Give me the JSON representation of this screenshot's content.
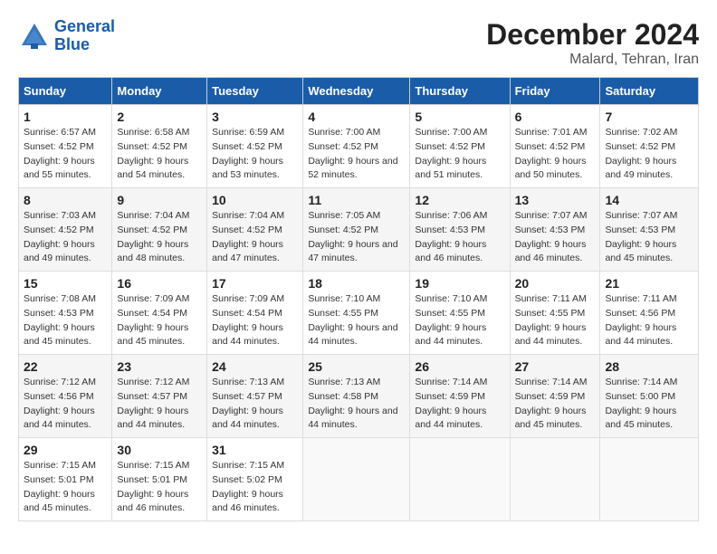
{
  "header": {
    "logo_line1": "General",
    "logo_line2": "Blue",
    "main_title": "December 2024",
    "subtitle": "Malard, Tehran, Iran"
  },
  "days_of_week": [
    "Sunday",
    "Monday",
    "Tuesday",
    "Wednesday",
    "Thursday",
    "Friday",
    "Saturday"
  ],
  "weeks": [
    [
      {
        "day": 1,
        "sunrise": "6:57 AM",
        "sunset": "4:52 PM",
        "daylight": "9 hours and 55 minutes."
      },
      {
        "day": 2,
        "sunrise": "6:58 AM",
        "sunset": "4:52 PM",
        "daylight": "9 hours and 54 minutes."
      },
      {
        "day": 3,
        "sunrise": "6:59 AM",
        "sunset": "4:52 PM",
        "daylight": "9 hours and 53 minutes."
      },
      {
        "day": 4,
        "sunrise": "7:00 AM",
        "sunset": "4:52 PM",
        "daylight": "9 hours and 52 minutes."
      },
      {
        "day": 5,
        "sunrise": "7:00 AM",
        "sunset": "4:52 PM",
        "daylight": "9 hours and 51 minutes."
      },
      {
        "day": 6,
        "sunrise": "7:01 AM",
        "sunset": "4:52 PM",
        "daylight": "9 hours and 50 minutes."
      },
      {
        "day": 7,
        "sunrise": "7:02 AM",
        "sunset": "4:52 PM",
        "daylight": "9 hours and 49 minutes."
      }
    ],
    [
      {
        "day": 8,
        "sunrise": "7:03 AM",
        "sunset": "4:52 PM",
        "daylight": "9 hours and 49 minutes."
      },
      {
        "day": 9,
        "sunrise": "7:04 AM",
        "sunset": "4:52 PM",
        "daylight": "9 hours and 48 minutes."
      },
      {
        "day": 10,
        "sunrise": "7:04 AM",
        "sunset": "4:52 PM",
        "daylight": "9 hours and 47 minutes."
      },
      {
        "day": 11,
        "sunrise": "7:05 AM",
        "sunset": "4:52 PM",
        "daylight": "9 hours and 47 minutes."
      },
      {
        "day": 12,
        "sunrise": "7:06 AM",
        "sunset": "4:53 PM",
        "daylight": "9 hours and 46 minutes."
      },
      {
        "day": 13,
        "sunrise": "7:07 AM",
        "sunset": "4:53 PM",
        "daylight": "9 hours and 46 minutes."
      },
      {
        "day": 14,
        "sunrise": "7:07 AM",
        "sunset": "4:53 PM",
        "daylight": "9 hours and 45 minutes."
      }
    ],
    [
      {
        "day": 15,
        "sunrise": "7:08 AM",
        "sunset": "4:53 PM",
        "daylight": "9 hours and 45 minutes."
      },
      {
        "day": 16,
        "sunrise": "7:09 AM",
        "sunset": "4:54 PM",
        "daylight": "9 hours and 45 minutes."
      },
      {
        "day": 17,
        "sunrise": "7:09 AM",
        "sunset": "4:54 PM",
        "daylight": "9 hours and 44 minutes."
      },
      {
        "day": 18,
        "sunrise": "7:10 AM",
        "sunset": "4:55 PM",
        "daylight": "9 hours and 44 minutes."
      },
      {
        "day": 19,
        "sunrise": "7:10 AM",
        "sunset": "4:55 PM",
        "daylight": "9 hours and 44 minutes."
      },
      {
        "day": 20,
        "sunrise": "7:11 AM",
        "sunset": "4:55 PM",
        "daylight": "9 hours and 44 minutes."
      },
      {
        "day": 21,
        "sunrise": "7:11 AM",
        "sunset": "4:56 PM",
        "daylight": "9 hours and 44 minutes."
      }
    ],
    [
      {
        "day": 22,
        "sunrise": "7:12 AM",
        "sunset": "4:56 PM",
        "daylight": "9 hours and 44 minutes."
      },
      {
        "day": 23,
        "sunrise": "7:12 AM",
        "sunset": "4:57 PM",
        "daylight": "9 hours and 44 minutes."
      },
      {
        "day": 24,
        "sunrise": "7:13 AM",
        "sunset": "4:57 PM",
        "daylight": "9 hours and 44 minutes."
      },
      {
        "day": 25,
        "sunrise": "7:13 AM",
        "sunset": "4:58 PM",
        "daylight": "9 hours and 44 minutes."
      },
      {
        "day": 26,
        "sunrise": "7:14 AM",
        "sunset": "4:59 PM",
        "daylight": "9 hours and 44 minutes."
      },
      {
        "day": 27,
        "sunrise": "7:14 AM",
        "sunset": "4:59 PM",
        "daylight": "9 hours and 45 minutes."
      },
      {
        "day": 28,
        "sunrise": "7:14 AM",
        "sunset": "5:00 PM",
        "daylight": "9 hours and 45 minutes."
      }
    ],
    [
      {
        "day": 29,
        "sunrise": "7:15 AM",
        "sunset": "5:01 PM",
        "daylight": "9 hours and 45 minutes."
      },
      {
        "day": 30,
        "sunrise": "7:15 AM",
        "sunset": "5:01 PM",
        "daylight": "9 hours and 46 minutes."
      },
      {
        "day": 31,
        "sunrise": "7:15 AM",
        "sunset": "5:02 PM",
        "daylight": "9 hours and 46 minutes."
      },
      null,
      null,
      null,
      null
    ]
  ],
  "labels": {
    "sunrise_prefix": "Sunrise: ",
    "sunset_prefix": "Sunset: ",
    "daylight_label": "Daylight: "
  }
}
